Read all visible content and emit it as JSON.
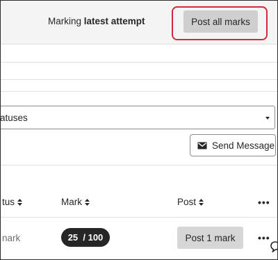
{
  "header": {
    "marking_prefix": "Marking",
    "marking_strong": "latest attempt",
    "post_all_label": "Post all marks"
  },
  "filters": {
    "status_select_value": "atuses"
  },
  "actions": {
    "send_message_label": "Send Message",
    "send_message_icon": "envelope-icon"
  },
  "table": {
    "columns": {
      "status": "tus",
      "mark": "Mark",
      "post": "Post",
      "more": "•••"
    },
    "rows": [
      {
        "status": "nark",
        "mark": "25  / 100",
        "post_label": "Post 1 mark",
        "more": "•••"
      }
    ]
  },
  "colors": {
    "highlight_border": "#d22a36",
    "button_gray": "#cfcfcf",
    "pill_dark": "#262626"
  }
}
